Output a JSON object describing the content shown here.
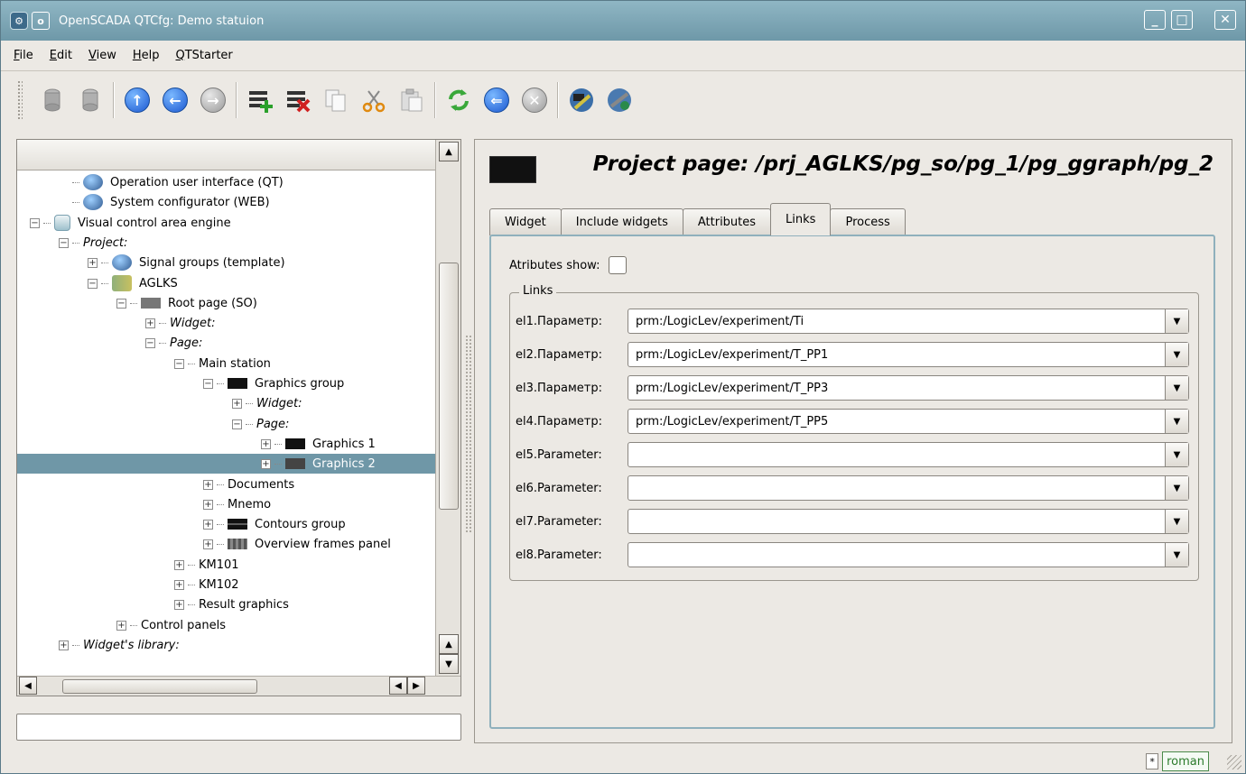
{
  "window": {
    "title": "OpenSCADA QTCfg: Demo statuion",
    "pin_glyph": "o",
    "minimize_glyph": "_",
    "maximize_glyph": "□",
    "close_glyph": "✕"
  },
  "menu": [
    "File",
    "Edit",
    "View",
    "Help",
    "QTStarter"
  ],
  "toolbar": {
    "icons": [
      "db-load-icon",
      "db-save-icon",
      "up-icon",
      "back-icon",
      "forward-icon",
      "add-item-icon",
      "delete-item-icon",
      "copy-icon",
      "cut-icon",
      "paste-icon",
      "refresh-icon",
      "start-icon",
      "stop-icon",
      "ui-qt-icon",
      "ui-web-icon"
    ]
  },
  "tree": {
    "header": "",
    "items": [
      {
        "label": "Operation user interface (QT)",
        "depth": 1,
        "expander": "none",
        "icon": "round",
        "italic": false,
        "selected": false
      },
      {
        "label": "System configurator (WEB)",
        "depth": 1,
        "expander": "none",
        "icon": "round",
        "italic": false,
        "selected": false
      },
      {
        "label": "Visual control area engine",
        "depth": 0,
        "expander": "-",
        "icon": "cyl",
        "italic": false,
        "selected": false
      },
      {
        "label": "Project:",
        "depth": 1,
        "expander": "-",
        "icon": "",
        "italic": true,
        "selected": false
      },
      {
        "label": "Signal groups (template)",
        "depth": 2,
        "expander": "+",
        "icon": "round",
        "italic": false,
        "selected": false
      },
      {
        "label": "AGLKS",
        "depth": 2,
        "expander": "-",
        "icon": "lib",
        "italic": false,
        "selected": false
      },
      {
        "label": "Root page (SO)",
        "depth": 3,
        "expander": "-",
        "icon": "mgrey",
        "italic": false,
        "selected": false
      },
      {
        "label": "Widget:",
        "depth": 4,
        "expander": "+",
        "icon": "",
        "italic": true,
        "selected": false
      },
      {
        "label": "Page:",
        "depth": 4,
        "expander": "-",
        "icon": "",
        "italic": true,
        "selected": false
      },
      {
        "label": "Main station",
        "depth": 5,
        "expander": "-",
        "icon": "",
        "italic": false,
        "selected": false
      },
      {
        "label": "Graphics group",
        "depth": 6,
        "expander": "-",
        "icon": "black",
        "italic": false,
        "selected": false
      },
      {
        "label": "Widget:",
        "depth": 7,
        "expander": "+",
        "icon": "",
        "italic": true,
        "selected": false
      },
      {
        "label": "Page:",
        "depth": 7,
        "expander": "-",
        "icon": "",
        "italic": true,
        "selected": false
      },
      {
        "label": "Graphics 1",
        "depth": 8,
        "expander": "+",
        "icon": "black",
        "italic": false,
        "selected": false
      },
      {
        "label": "Graphics 2",
        "depth": 8,
        "expander": "+",
        "icon": "dgrey",
        "italic": false,
        "selected": true
      },
      {
        "label": "Documents",
        "depth": 6,
        "expander": "+",
        "icon": "",
        "italic": false,
        "selected": false
      },
      {
        "label": "Mnemo",
        "depth": 6,
        "expander": "+",
        "icon": "",
        "italic": false,
        "selected": false
      },
      {
        "label": "Contours group",
        "depth": 6,
        "expander": "+",
        "icon": "stripe",
        "italic": false,
        "selected": false
      },
      {
        "label": "Overview frames panel",
        "depth": 6,
        "expander": "+",
        "icon": "ov",
        "italic": false,
        "selected": false
      },
      {
        "label": "KM101",
        "depth": 5,
        "expander": "+",
        "icon": "",
        "italic": false,
        "selected": false
      },
      {
        "label": "KM102",
        "depth": 5,
        "expander": "+",
        "icon": "",
        "italic": false,
        "selected": false
      },
      {
        "label": "Result graphics",
        "depth": 5,
        "expander": "+",
        "icon": "",
        "italic": false,
        "selected": false
      },
      {
        "label": "Control panels",
        "depth": 3,
        "expander": "+",
        "icon": "",
        "italic": false,
        "selected": false
      },
      {
        "label": "Widget's library:",
        "depth": 1,
        "expander": "+",
        "icon": "",
        "italic": true,
        "selected": false
      }
    ]
  },
  "status_field": "",
  "page": {
    "title": "Project page: /prj_AGLKS/pg_so/pg_1/pg_ggraph/pg_2",
    "tabs": [
      {
        "label": "Widget",
        "active": false
      },
      {
        "label": "Include widgets",
        "active": false
      },
      {
        "label": "Attributes",
        "active": false
      },
      {
        "label": "Links",
        "active": true
      },
      {
        "label": "Process",
        "active": false
      }
    ],
    "attributes_show_label": "Atributes show:",
    "links_group_title": "Links",
    "links": [
      {
        "label": "el1.Параметр:",
        "value": "prm:/LogicLev/experiment/Ti"
      },
      {
        "label": "el2.Параметр:",
        "value": "prm:/LogicLev/experiment/T_PP1"
      },
      {
        "label": "el3.Параметр:",
        "value": "prm:/LogicLev/experiment/T_PP3"
      },
      {
        "label": "el4.Параметр:",
        "value": "prm:/LogicLev/experiment/T_PP5"
      },
      {
        "label": "el5.Parameter:",
        "value": ""
      },
      {
        "label": "el6.Parameter:",
        "value": ""
      },
      {
        "label": "el7.Parameter:",
        "value": ""
      },
      {
        "label": "el8.Parameter:",
        "value": ""
      }
    ]
  },
  "statusbar": {
    "modified_marker": "*",
    "user": "roman"
  },
  "colors": {
    "titlebar": "#7fa8b8",
    "selection": "#6f97a7",
    "tab_frame": "#8fb0bc"
  }
}
